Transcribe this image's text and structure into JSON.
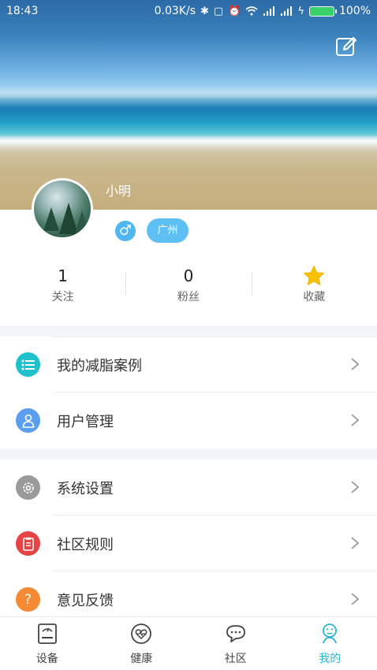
{
  "status_bar": {
    "time": "18:43",
    "network_speed": "0.03K/s",
    "battery": "100%",
    "icons": [
      "bluetooth-icon",
      "vibrate-off-icon",
      "alarm-icon",
      "wifi-icon",
      "signal-icon",
      "signal-icon",
      "charging-icon",
      "battery-icon"
    ]
  },
  "profile": {
    "name": "小明",
    "gender_symbol": "♂",
    "city": "广州",
    "accent_color": "#5ec0f2"
  },
  "stats": [
    {
      "value": "1",
      "label": "关注"
    },
    {
      "value": "0",
      "label": "粉丝"
    },
    {
      "value": "",
      "label": "收藏",
      "icon": "star-icon"
    }
  ],
  "menu": {
    "group1": [
      {
        "label": "我的减脂案例",
        "icon": "list-icon",
        "color": "#1fc1cc"
      },
      {
        "label": "用户管理",
        "icon": "user-icon",
        "color": "#5b9ef0"
      }
    ],
    "group2": [
      {
        "label": "系统设置",
        "icon": "gear-icon",
        "color": "#9a9a9a"
      },
      {
        "label": "社区规则",
        "icon": "document-icon",
        "color": "#e64444"
      },
      {
        "label": "意见反馈",
        "icon": "question-icon",
        "color": "#f58a35",
        "glyph": "?"
      }
    ]
  },
  "tabbar": [
    {
      "label": "设备",
      "icon": "scale-icon",
      "active": false
    },
    {
      "label": "健康",
      "icon": "heart-icon",
      "active": false
    },
    {
      "label": "社区",
      "icon": "chat-icon",
      "active": false
    },
    {
      "label": "我的",
      "icon": "profile-icon",
      "active": true
    }
  ],
  "active_color": "#2ab5d6"
}
